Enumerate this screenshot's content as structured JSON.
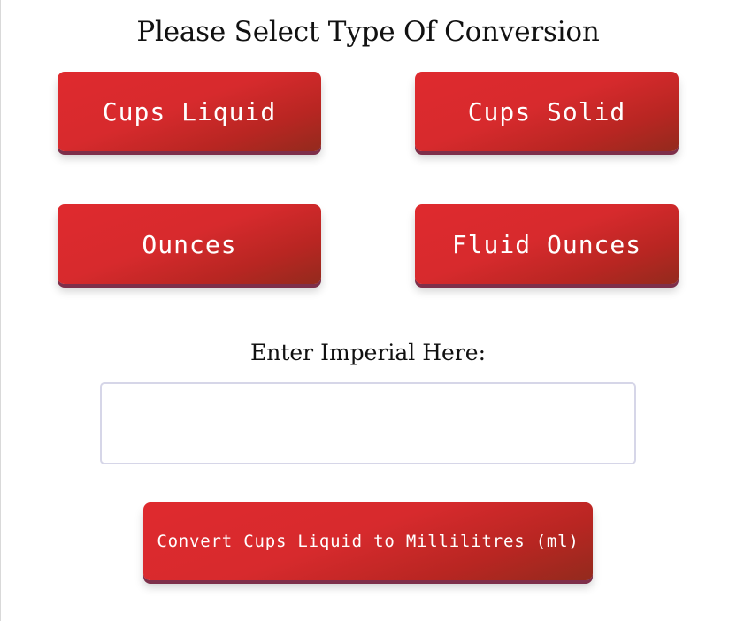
{
  "page": {
    "title": "Please Select Type Of Conversion"
  },
  "conversion_types": {
    "cups_liquid": "Cups Liquid",
    "cups_solid": "Cups Solid",
    "ounces": "Ounces",
    "fluid_ounces": "Fluid Ounces"
  },
  "input": {
    "label": "Enter Imperial Here:",
    "value": "",
    "placeholder": ""
  },
  "convert": {
    "label": "Convert Cups Liquid to Millilitres (ml)"
  },
  "colors": {
    "button_red": "#d72a2d",
    "button_dark": "#932a1d",
    "button_shadow": "#7e2f4a",
    "input_border": "#d6d6e8"
  }
}
